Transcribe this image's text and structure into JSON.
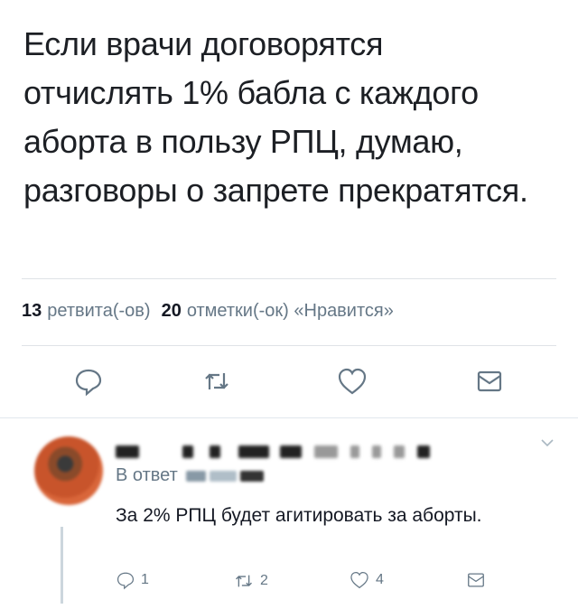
{
  "tweet": {
    "text": "Если врачи договорятся\nотчислять 1% бабла с каждого\nаборта в пользу РПЦ, думаю,\nразговоры о запрете прекратятся.",
    "retweets_count": "13",
    "retweets_label": "ретвита(-ов)",
    "likes_count": "20",
    "likes_label": "отметки(-ок) «Нравится»"
  },
  "reply": {
    "in_reply_prefix": "В ответ",
    "text": "За 2% РПЦ будет агитировать за аборты.",
    "reply_count": "1",
    "retweet_count": "2",
    "like_count": "4"
  },
  "colors": {
    "text": "#141823",
    "secondary": "#657786",
    "divider": "#dfe3e7"
  },
  "icons": [
    "reply-icon",
    "retweet-icon",
    "like-icon",
    "share-icon",
    "chevron-down-icon"
  ]
}
